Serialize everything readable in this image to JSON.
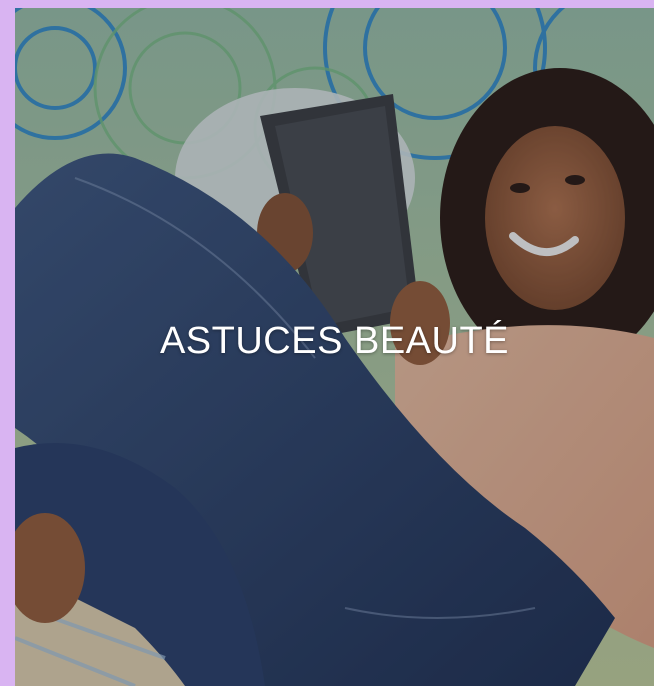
{
  "tile": {
    "caption": "ASTUCES BEAUTÉ",
    "background_color": "#D9B4F2",
    "caption_color": "#FFFFFF"
  }
}
